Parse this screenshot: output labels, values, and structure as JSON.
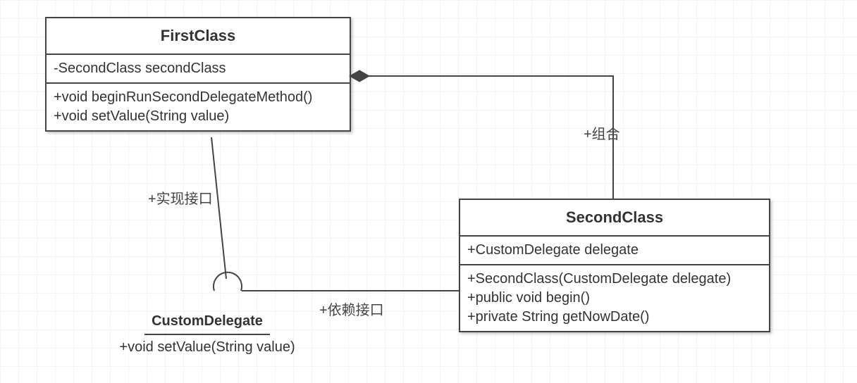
{
  "first": {
    "name": "FirstClass",
    "attrs": [
      "-SecondClass secondClass"
    ],
    "ops": [
      "+void beginRunSecondDelegateMethod()",
      "+void setValue(String value)"
    ]
  },
  "second": {
    "name": "SecondClass",
    "attrs": [
      "+CustomDelegate delegate"
    ],
    "ops": [
      "+SecondClass(CustomDelegate delegate)",
      "+public void begin()",
      "+private String getNowDate()"
    ]
  },
  "iface": {
    "name": "CustomDelegate",
    "ops": [
      "+void setValue(String value)"
    ]
  },
  "labels": {
    "composition": "+组合",
    "realize": "+实现接口",
    "dependency": "+依赖接口"
  }
}
